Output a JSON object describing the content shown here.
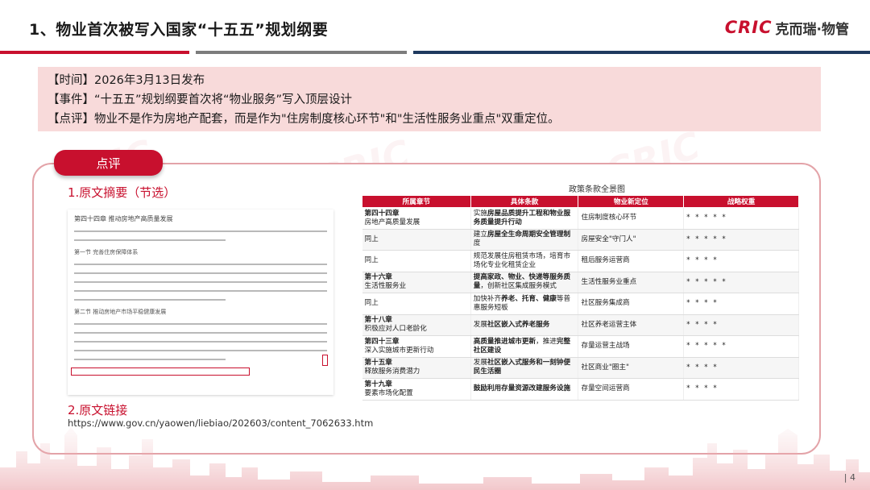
{
  "header": {
    "title": "1、物业首次被写入国家“十五五”规划纲要",
    "logo_brand": "CRIC",
    "logo_name": "克而瑞·物管"
  },
  "info": {
    "time": "【时间】2026年3月13日发布",
    "event": "【事件】“十五五”规划纲要首次将“物业服务”写入顶层设计",
    "comment": "【点评】物业不是作为房地产配套，而是作为\"住房制度核心环节\"和\"生活性服务业重点\"双重定位。"
  },
  "card": {
    "pill_label": "点评",
    "section1_title": "1.原文摘要（节选）",
    "section2_title": "2.原文链接",
    "link_url": "https://www.gov.cn/yaowen/liebiao/202603/content_7062633.htm"
  },
  "table": {
    "caption": "政策条款全景图",
    "headers": [
      "所属章节",
      "具体条款",
      "物业新定位",
      "战略权重"
    ],
    "rows": [
      {
        "chapter": "第四十四章\n房地产高质量发展",
        "clause": "实施房屋品质提升工程和物业服务质量提升行动",
        "position": "住房制度核心环节",
        "weight": "* * * * *"
      },
      {
        "chapter": "同上",
        "clause": "建立房屋全生命周期安全管理制度",
        "position": "房屋安全\"守门人\"",
        "weight": "* * * * *"
      },
      {
        "chapter": "同上",
        "clause": "规范发展住房租赁市场，培育市场化专业化租赁企业",
        "position": "租后服务运营商",
        "weight": "* * * *"
      },
      {
        "chapter": "第十六章\n生活性服务业",
        "clause": "提高家政、物业、快递等服务质量，创新社区集成服务模式",
        "position": "生活性服务业重点",
        "weight": "* * * * *"
      },
      {
        "chapter": "同上",
        "clause": "加快补齐养老、托育、健康等普惠服务短板",
        "position": "社区服务集成商",
        "weight": "* * * *"
      },
      {
        "chapter": "第十八章\n积极应对人口老龄化",
        "clause": "发展社区嵌入式养老服务",
        "position": "社区养老运营主体",
        "weight": "* * * *"
      },
      {
        "chapter": "第四十三章\n深入实施城市更新行动",
        "clause": "高质量推进城市更新，推进完整社区建设",
        "position": "存量运营主战场",
        "weight": "* * * * *"
      },
      {
        "chapter": "第十五章\n释放服务消费潜力",
        "clause": "发展社区嵌入式服务和一刻钟便民生活圈",
        "position": "社区商业\"圈主\"",
        "weight": "* * * *"
      },
      {
        "chapter": "第十九章\n要素市场化配置",
        "clause": "鼓励利用存量资源改建服务设施",
        "position": "存量空间运营商",
        "weight": "* * * *"
      }
    ]
  },
  "document": {
    "title": "第四十四章 推动房地产高质量发展",
    "section1": "第一节 完善住房保障体系",
    "section2": "第二节 推动房地产市场平稳健康发展"
  },
  "footer": {
    "page": "| 4"
  },
  "colors": {
    "accent": "#c8102e",
    "navy": "#1f3a5f",
    "band": "#f8dada"
  }
}
